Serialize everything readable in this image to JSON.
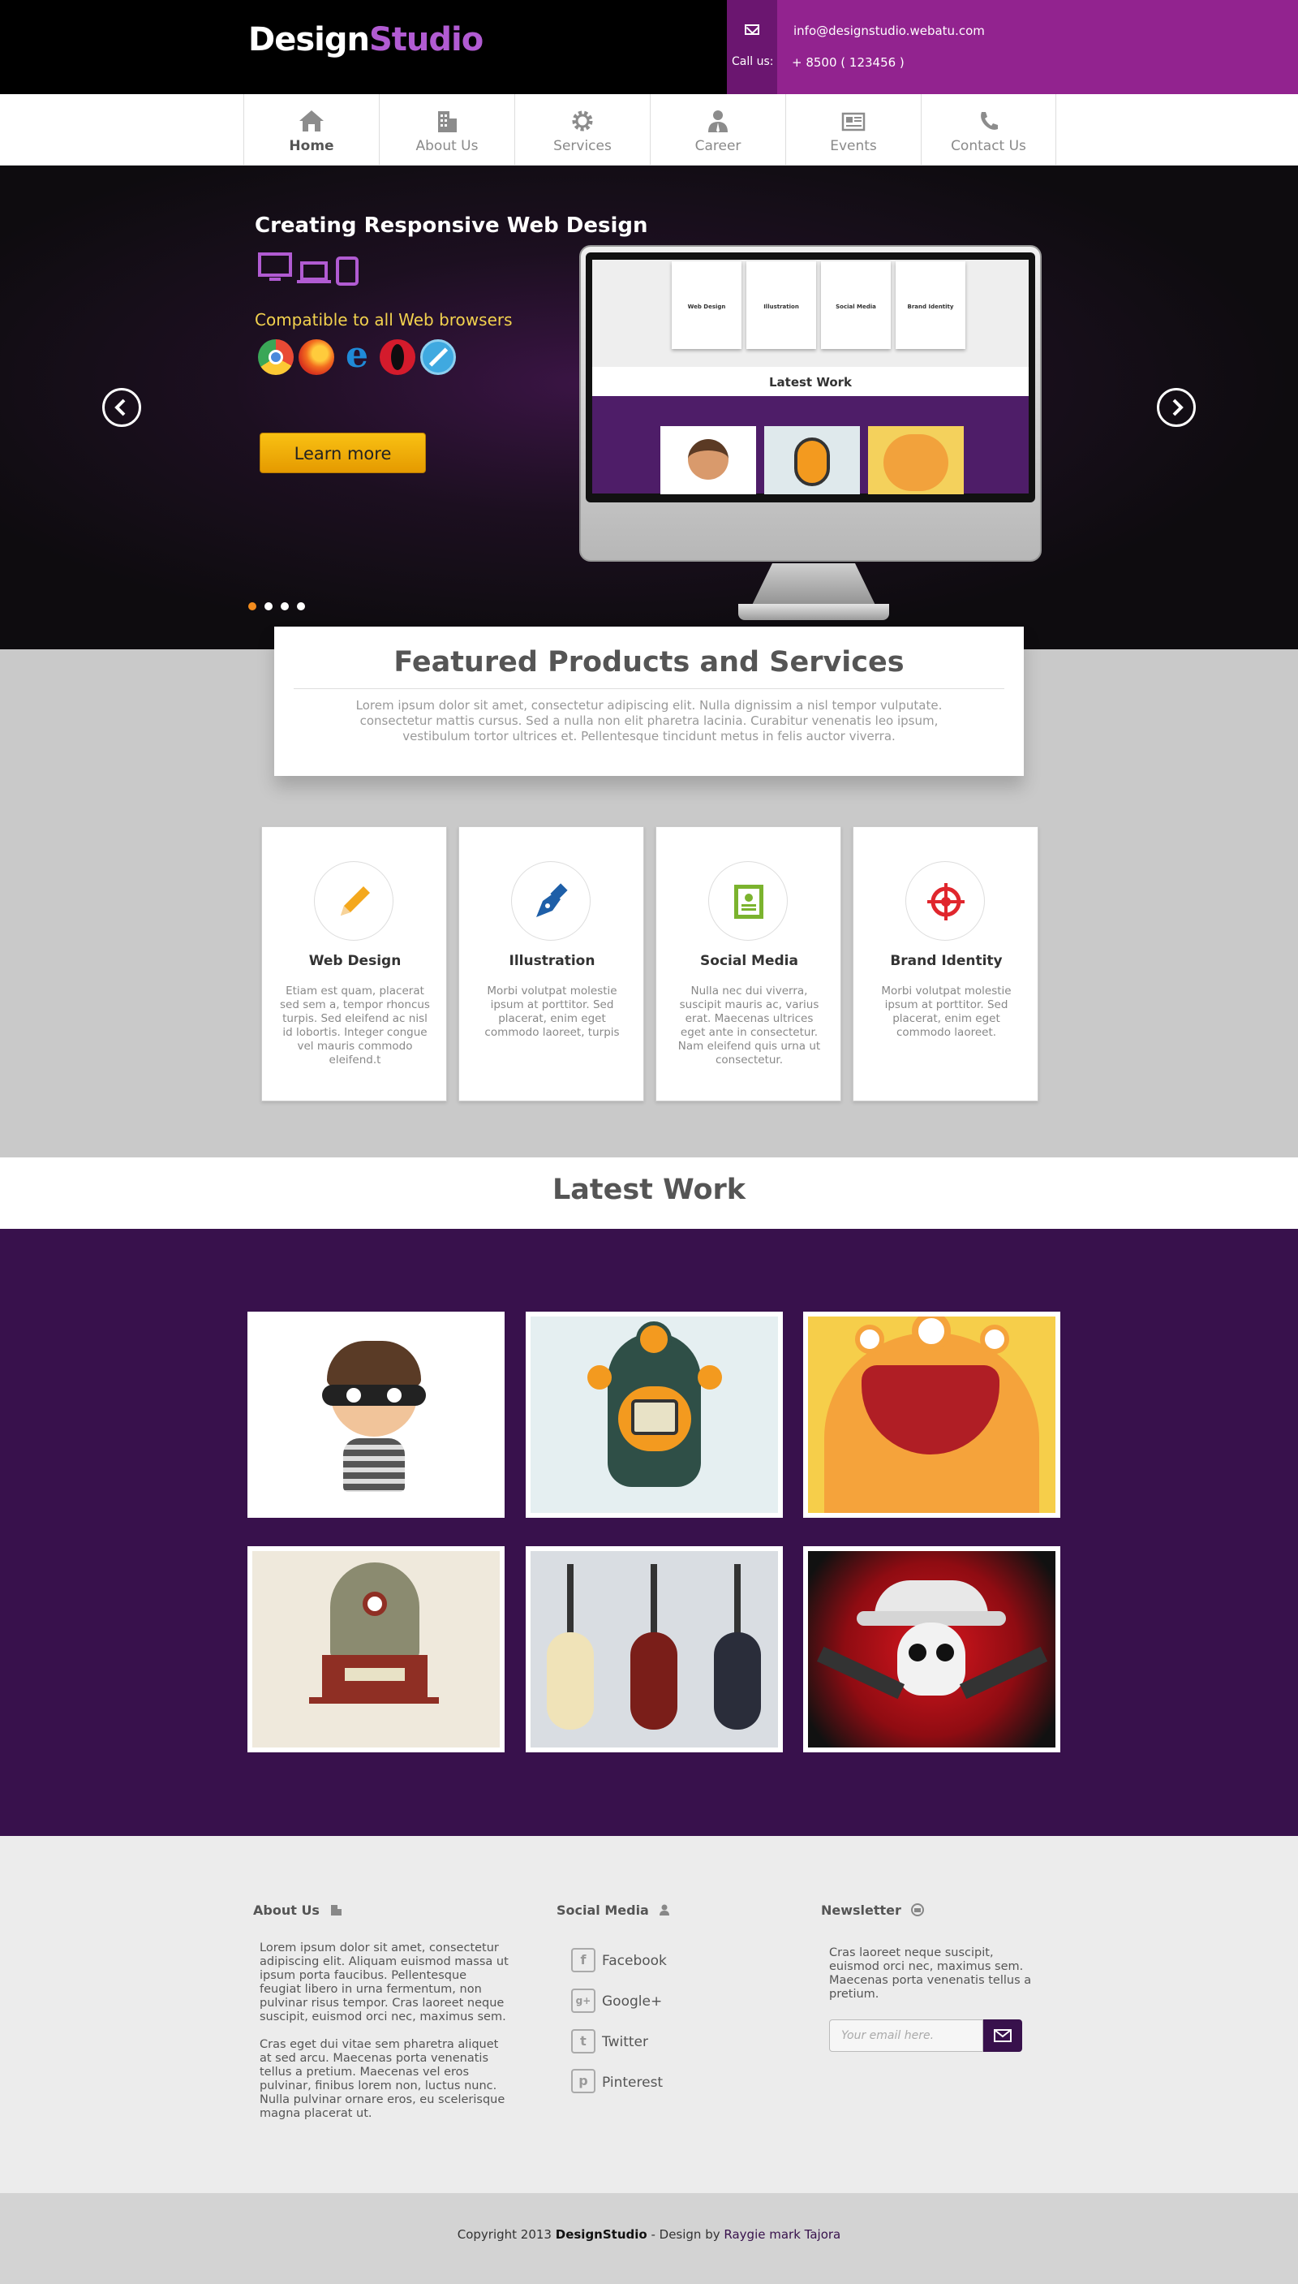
{
  "header": {
    "logo_part1": "Design",
    "logo_part2": "Studio",
    "email": "info@designstudio.webatu.com",
    "call_label": "Call us:",
    "phone": "+ 8500 ( 123456 )"
  },
  "nav": {
    "items": [
      {
        "label": "Home",
        "icon": "home-icon",
        "active": true
      },
      {
        "label": "About Us",
        "icon": "building-icon"
      },
      {
        "label": "Services",
        "icon": "gear-icon"
      },
      {
        "label": "Career",
        "icon": "user-icon"
      },
      {
        "label": "Events",
        "icon": "newspaper-icon"
      },
      {
        "label": "Contact Us",
        "icon": "phone-icon"
      }
    ]
  },
  "hero": {
    "title": "Creating Responsive Web Design",
    "subtitle": "Compatible to all Web browsers",
    "button": "Learn more",
    "monitor_latest": "Latest Work",
    "mini_cards": [
      "Web Design",
      "Illustration",
      "Social Media",
      "Brand Identity"
    ],
    "slide_active": 1,
    "slide_count": 4
  },
  "featured": {
    "title": "Featured Products and Services",
    "text": "Lorem ipsum dolor sit amet, consectetur adipiscing elit. Nulla dignissim a nisl tempor vulputate. consectetur mattis cursus. Sed a nulla non elit pharetra lacinia. Curabitur venenatis leo ipsum, vestibulum tortor ultrices et. Pellentesque tincidunt metus in felis auctor viverra."
  },
  "services": [
    {
      "title": "Web Design",
      "text": "Etiam est quam, placerat sed sem a, tempor rhoncus turpis. Sed eleifend ac nisl id lobortis. Integer congue vel mauris commodo eleifend.t",
      "icon": "pencil-icon",
      "color": "#f4a81d"
    },
    {
      "title": "Illustration",
      "text": "Morbi volutpat molestie ipsum at porttitor. Sed placerat, enim eget commodo laoreet, turpis",
      "icon": "pen-nib-icon",
      "color": "#1e5fa8"
    },
    {
      "title": "Social Media",
      "text": "Nulla nec dui viverra, suscipit mauris ac, varius erat. Maecenas ultrices eget ante in consectetur. Nam eleifend quis urna ut consectetur.",
      "icon": "profile-card-icon",
      "color": "#7bb32e"
    },
    {
      "title": "Brand Identity",
      "text": "Morbi volutpat molestie ipsum at porttitor. Sed placerat, enim eget commodo laoreet.",
      "icon": "target-icon",
      "color": "#e0262d"
    }
  ],
  "latest_work": {
    "title": "Latest Work",
    "items": [
      "thief-boy",
      "cyclops-robot",
      "orange-monster",
      "retro-robot",
      "three-guitars",
      "skull-cowboy"
    ]
  },
  "footer": {
    "about_title": "About Us",
    "about_p1": "Lorem ipsum dolor sit amet, consectetur adipiscing elit. Aliquam euismod massa ut ipsum porta faucibus. Pellentesque feugiat libero in urna fermentum, non pulvinar risus tempor. Cras laoreet neque suscipit, euismod orci nec, maximus sem.",
    "about_p2": "Cras eget dui vitae sem pharetra aliquet at sed arcu.  Maecenas porta venenatis tellus a pretium. Maecenas vel eros pulvinar, finibus lorem non, luctus nunc. Nulla pulvinar ornare eros, eu scelerisque magna placerat ut.",
    "social_title": "Social Media",
    "social": [
      {
        "label": "Facebook",
        "glyph": "f"
      },
      {
        "label": "Google+",
        "glyph": "g+"
      },
      {
        "label": "Twitter",
        "glyph": "t"
      },
      {
        "label": "Pinterest",
        "glyph": "p"
      }
    ],
    "newsletter_title": "Newsletter",
    "newsletter_text": "Cras laoreet neque suscipit, euismod orci nec, maximus sem.  Maecenas porta venenatis tellus a pretium.",
    "email_placeholder": "Your email here.",
    "copy_prefix": "Copyright 2013 ",
    "copy_brand": "DesignStudio",
    "copy_mid": " - Design by ",
    "copy_author": "Raygie mark Tajora"
  }
}
